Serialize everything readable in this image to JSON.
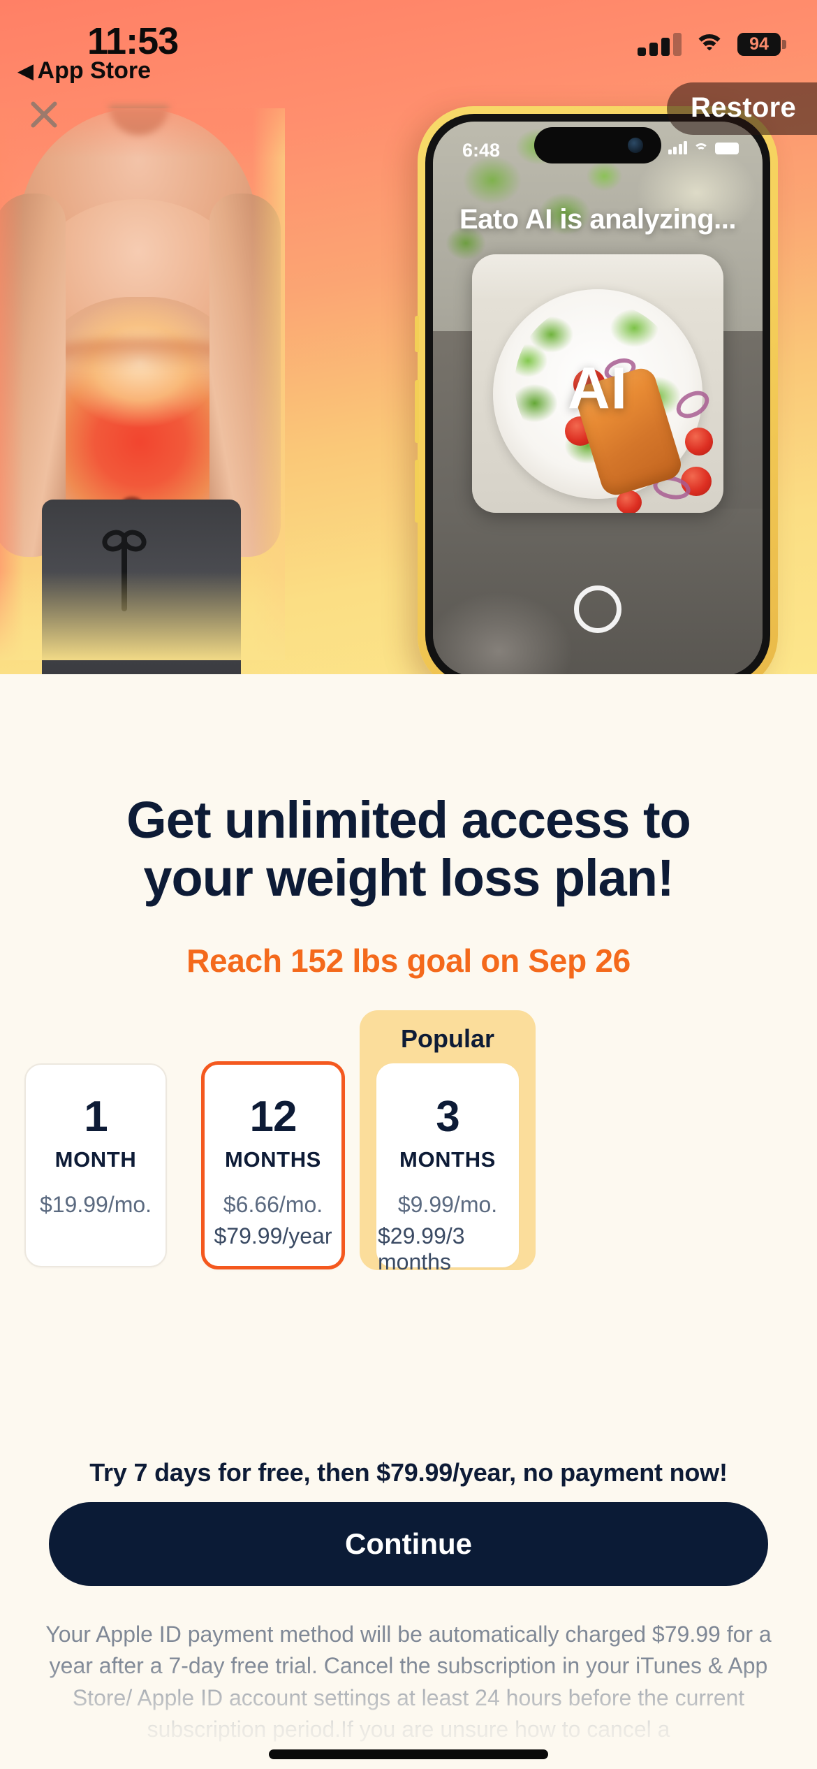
{
  "status_bar": {
    "time": "11:53",
    "battery_level": "94",
    "back_label": "App Store",
    "back_arrow": "◀",
    "signal_icon": "cellular-signal-icon",
    "wifi_icon": "wifi-icon",
    "battery_icon": "battery-icon"
  },
  "hero": {
    "close_icon": "close-icon",
    "restore_label": "Restore",
    "body_illustration": "overweight-torso-illustration",
    "phone_mockup": {
      "time": "6:48",
      "headline": "Eato AI is analyzing...",
      "food_image": "salmon-salad-photo",
      "ai_badge": "AI",
      "shutter_icon": "camera-shutter-icon"
    }
  },
  "main": {
    "title_line1": "Get unlimited access to",
    "title_line2": "your weight loss plan!",
    "subtitle": "Reach 152 lbs goal on Sep 26",
    "popular_badge": "Popular",
    "plans": [
      {
        "num": "1",
        "unit": "MONTH",
        "price_primary": "$19.99/mo.",
        "price_secondary": "",
        "selected": false,
        "popular": false
      },
      {
        "num": "12",
        "unit": "MONTHS",
        "price_primary": "$6.66/mo.",
        "price_secondary": "$79.99/year",
        "selected": true,
        "popular": false
      },
      {
        "num": "3",
        "unit": "MONTHS",
        "price_primary": "$9.99/mo.",
        "price_secondary": "$29.99/3 months",
        "selected": false,
        "popular": true
      }
    ],
    "trial_text": "Try 7 days for free, then $79.99/year, no payment now!",
    "continue_label": "Continue",
    "legal_text": "Your Apple ID payment method will be automatically charged $79.99 for a year after a 7-day free trial. Cancel the subscription in your iTunes & App Store/ Apple ID account settings at least 24 hours before the current subscription period.If you are unsure how to cancel a"
  },
  "colors": {
    "accent_orange": "#F4581E",
    "subtitle_orange": "#F4691B",
    "navy": "#0D1B36",
    "popular_yellow": "#FBDD9B",
    "page_bg": "#FDF9F0"
  }
}
